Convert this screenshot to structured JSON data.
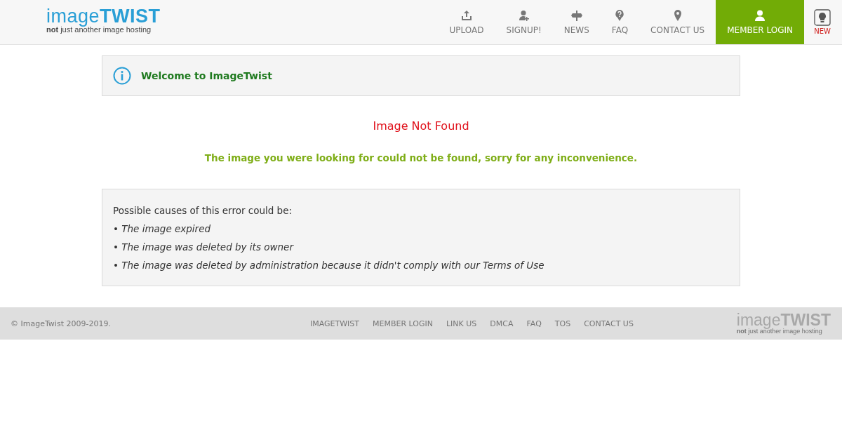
{
  "header": {
    "logo": "image**TWIST**",
    "tagline": "**not** just another image hosting",
    "nav": [
      {
        "label": "UPLOAD",
        "kind": "upload",
        "selected": false
      },
      {
        "label": "SIGNUP!",
        "kind": "signup",
        "selected": false
      },
      {
        "label": "NEWS",
        "kind": "news",
        "selected": false
      },
      {
        "label": "FAQ",
        "kind": "faq",
        "selected": false
      },
      {
        "label": "CONTACT US",
        "kind": "contact",
        "selected": false
      },
      {
        "label": "MEMBER LOGIN",
        "kind": "login",
        "selected": true
      }
    ],
    "new_badge": "NEW"
  },
  "welcome": "Welcome to ImageTwist",
  "error_title": "Image Not Found",
  "error_message": "The image you were looking for could not be found, sorry for any inconvenience.",
  "causes": {
    "heading": "Possible causes of this error could be:",
    "items": [
      "• The image expired",
      "• The image was deleted by its owner",
      "• The image was deleted by administration because it didn't comply with our Terms of Use"
    ]
  },
  "footer": {
    "copyright": "© ImageTwist 2009-2019.",
    "links": [
      "IMAGETWIST",
      "MEMBER LOGIN",
      "LINK US",
      "DMCA",
      "FAQ",
      "TOS",
      "CONTACT US"
    ],
    "logo": "image**TWIST**",
    "tagline": "**not** just another image hosting"
  }
}
